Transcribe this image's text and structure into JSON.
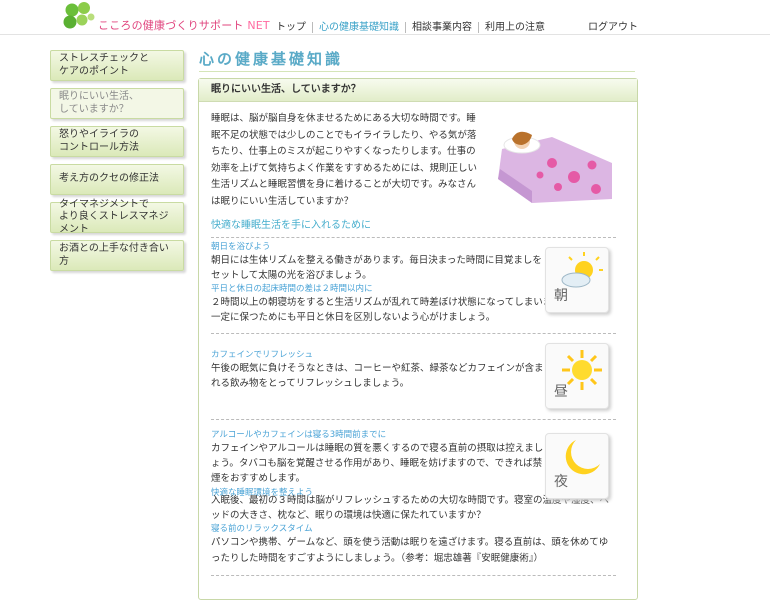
{
  "header": {
    "brand_prefix": "こころの健康づくりサポート",
    "brand_suffix": "NET",
    "nav": [
      "トップ",
      "心の健康基礎知識",
      "相談事業内容",
      "利用上の注意"
    ],
    "nav_active_index": 1,
    "logout": "ログアウト"
  },
  "sidebar": {
    "items": [
      {
        "line1": "ストレスチェックと",
        "line2": "ケアのポイント"
      },
      {
        "line1": "眠りにいい生活、",
        "line2": "していますか？",
        "current": true
      },
      {
        "line1": "怒りやイライラの",
        "line2": "コントロール方法"
      },
      {
        "line1": "考え方のクセの修正法",
        "line2": ""
      },
      {
        "line1": "タイマネジメントで",
        "line2": "より良くストレスマネジメント"
      },
      {
        "line1": "お酒との上手な付き合い方",
        "line2": ""
      }
    ]
  },
  "main": {
    "title": "心の健康基礎知識",
    "box_title": "眠りにいい生活、していますか？",
    "intro": "睡眠は、脳が脳自身を休ませるためにある大切な時間です。睡眠不足の状態では少しのことでもイライラしたり、やる気が落ちたり、仕事上のミスが起こりやすくなったりします。仕事の効率を上げて気持ちよく作業をすすめるためには、規則正しい生活リズムと睡眠習慣を身に着けることが大切です。みなさんは眠りにいい生活していますか？",
    "section_title": "快適な睡眠生活を手に入れるために",
    "blocks": {
      "morning": {
        "sub1": "朝日を浴びよう",
        "text1": "朝日には生体リズムを整える働きがあります。毎日決まった時間に目覚ましをセットして太陽の光を浴びましょう。",
        "sub2": "平日と休日の起床時間の差は２時間以内に",
        "text2": "２時間以上の朝寝坊をすると生活リズムが乱れて時差ぼけ状態になってしまいます。リズムを一定に保つためにも平日と休日を区別しないよう心がけましょう。",
        "kanji": "朝"
      },
      "noon": {
        "sub1": "カフェインでリフレッシュ",
        "text1": "午後の眠気に負けそうなときは、コーヒーや紅茶、緑茶などカフェインが含まれる飲み物をとってリフレッシュしましょう。",
        "kanji": "昼"
      },
      "night": {
        "sub1": "アルコールやカフェインは寝る3時間前までに",
        "text1": "カフェインやアルコールは睡眠の質を悪くするので寝る直前の摂取は控えましょう。タバコも脳を覚醒させる作用があり、睡眠を妨げますので、できれば禁煙をおすすめします。",
        "sub2": "快適な睡眠環境を整えよう",
        "text2": "入眠後、最初の３時間は脳がリフレッシュするための大切な時間です。寝室の温度や湿度、ベッドの大きさ、枕など、眠りの環境は快適に保たれていますか？",
        "sub3": "寝る前のリラックスタイム",
        "text3": "パソコンや携帯、ゲームなど、頭を使う活動は眠りを遠ざけます。寝る直前は、頭を休めてゆったりした時間をすごすようにしましょう。（参考：堀忠雄著『安眠健康術』）",
        "kanji": "夜"
      }
    }
  },
  "colors": {
    "brand": "#e0447e",
    "accent_blue": "#46aecd",
    "sidebar_green": "#dbe9b9"
  }
}
